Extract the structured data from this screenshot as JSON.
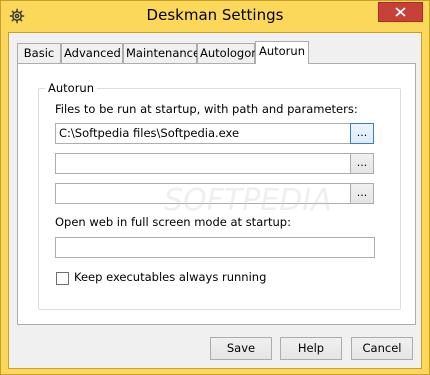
{
  "window": {
    "title": "Deskman Settings",
    "colors": {
      "titlebar": "#fbd85a",
      "close_button": "#c7413a",
      "panel_background": "#ffffff",
      "dialog_background": "#f0f0f0"
    }
  },
  "icons": {
    "app": "gear-icon",
    "close": "close-icon"
  },
  "tabs": [
    {
      "label": "Basic"
    },
    {
      "label": "Advanced"
    },
    {
      "label": "Maintenance"
    },
    {
      "label": "Autologon"
    },
    {
      "label": "Autorun"
    }
  ],
  "active_tab": "Autorun",
  "autorun": {
    "group_title": "Autorun",
    "files_label": "Files to be run at startup, with path and parameters:",
    "files": [
      {
        "value": "C:\\Softpedia files\\Softpedia.exe",
        "browse_label": "..."
      },
      {
        "value": "",
        "browse_label": "..."
      },
      {
        "value": "",
        "browse_label": "..."
      }
    ],
    "web_label": "Open web in full screen mode at startup:",
    "web_value": "",
    "keep_running_label": "Keep executables always running",
    "keep_running_checked": false
  },
  "watermark": "SOFTPEDIA",
  "buttons": {
    "save": "Save",
    "help": "Help",
    "cancel": "Cancel"
  }
}
